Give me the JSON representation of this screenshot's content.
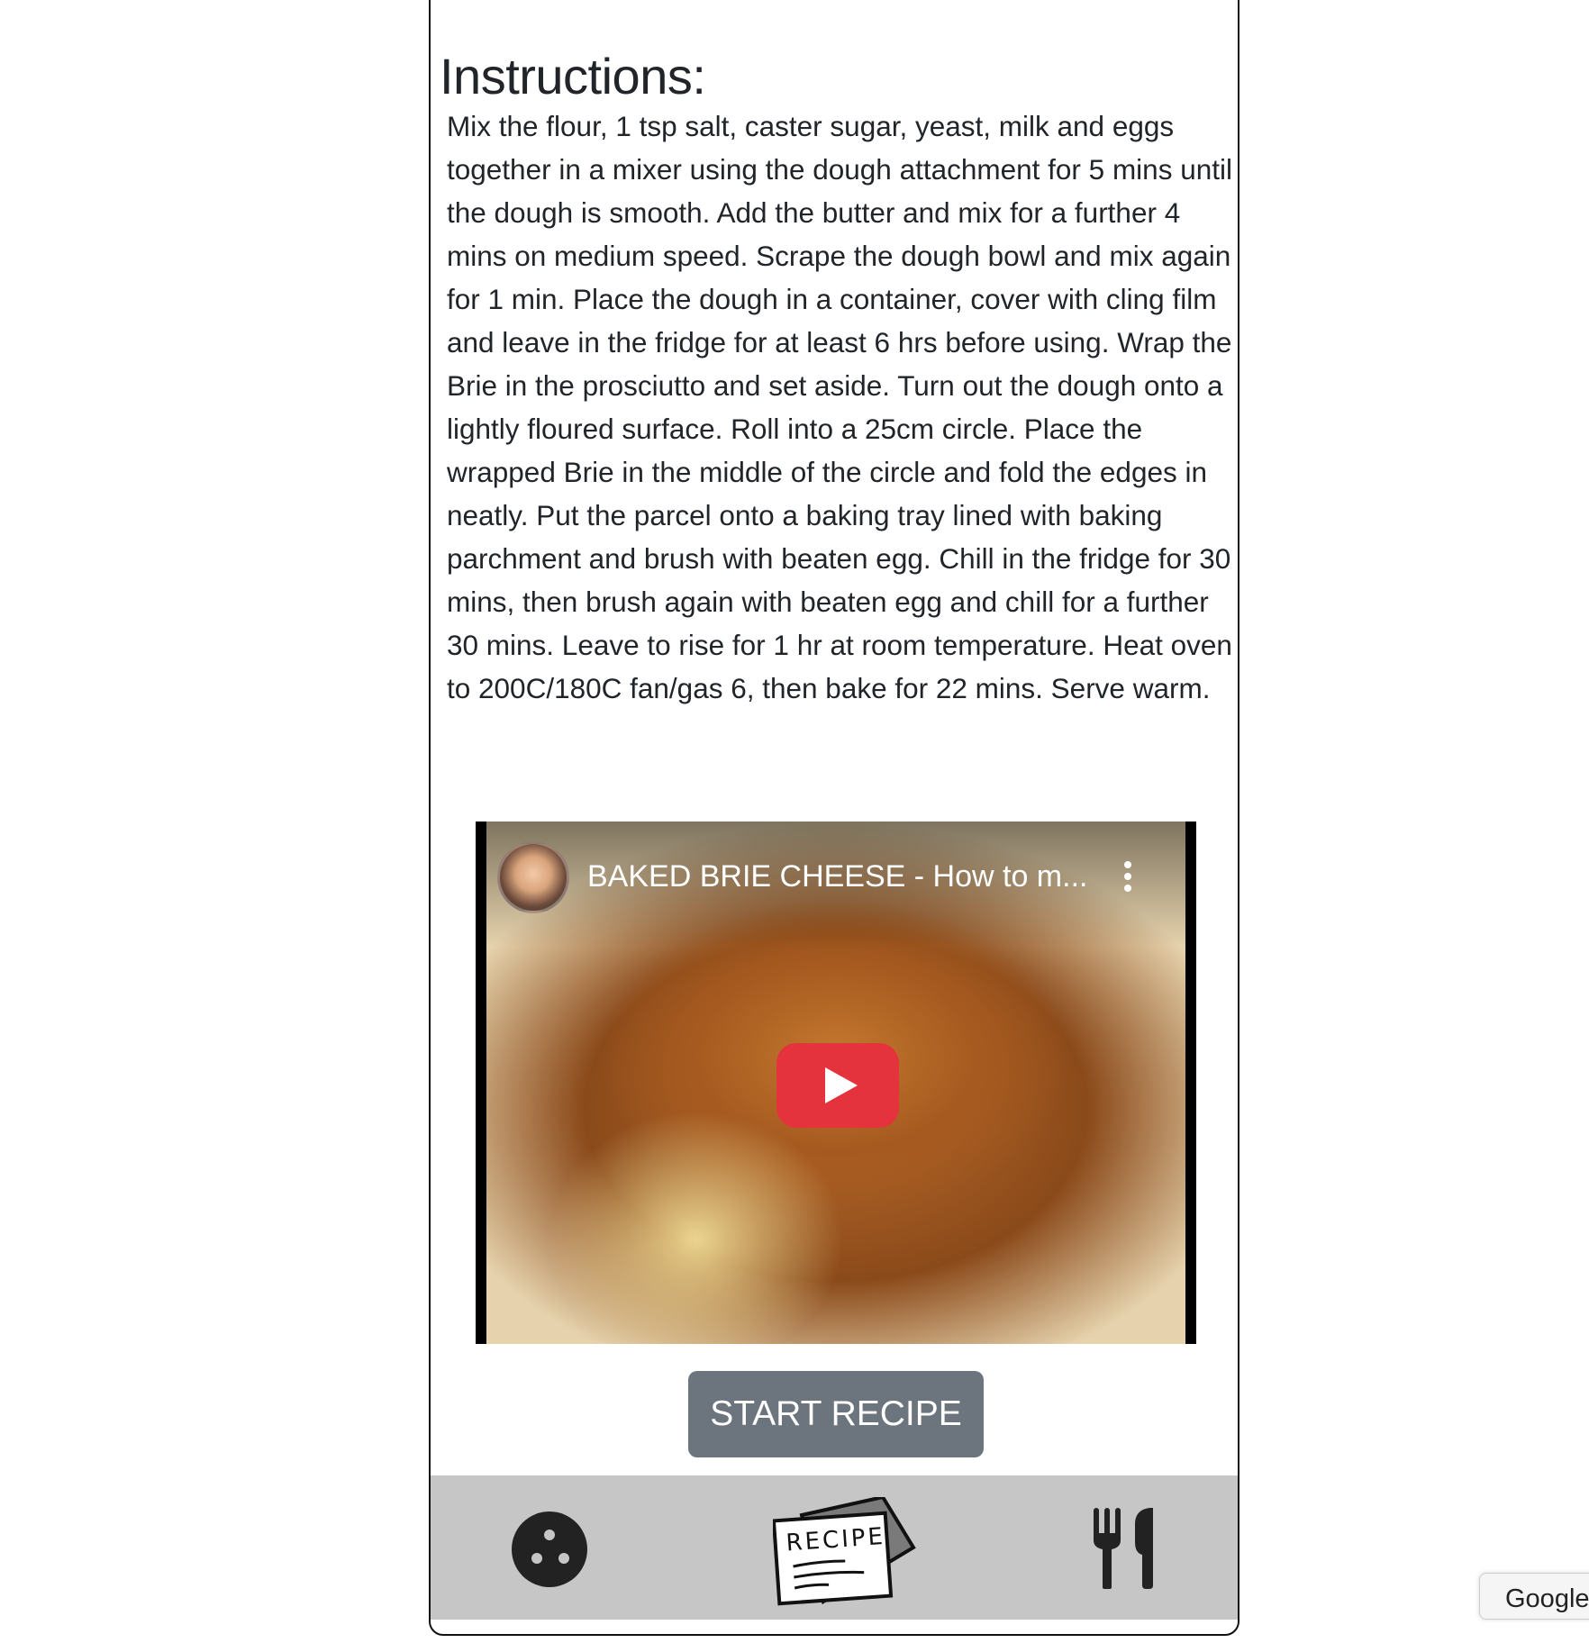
{
  "page": {
    "heading": "Instructions:",
    "instructions": "Mix the flour, 1 tsp salt, caster sugar, yeast, milk and eggs together in a mixer using the dough attachment for 5 mins until the dough is smooth. Add the butter and mix for a further 4 mins on medium speed. Scrape the dough bowl and mix again for 1 min. Place the dough in a container, cover with cling film and leave in the fridge for at least 6 hrs before using. Wrap the Brie in the prosciutto and set aside. Turn out the dough onto a lightly floured surface. Roll into a 25cm circle. Place the wrapped Brie in the middle of the circle and fold the edges in neatly. Put the parcel onto a baking tray lined with baking parchment and brush with beaten egg. Chill in the fridge for 30 mins, then brush again with beaten egg and chill for a further 30 mins. Leave to rise for 1 hr at room temperature. Heat oven to 200C/180C fan/gas 6, then bake for 22 mins. Serve warm."
  },
  "video": {
    "title": "BAKED BRIE CHEESE - How to m...",
    "play_color": "#e5333d"
  },
  "actions": {
    "start_label": "START RECIPE",
    "button_color": "#6c757d"
  },
  "nav": {
    "background": "#c6c6c6",
    "items": [
      {
        "icon": "cookie-icon"
      },
      {
        "icon": "recipe-card-icon",
        "text": "RECIPE"
      },
      {
        "icon": "fork-knife-icon"
      }
    ]
  },
  "browser": {
    "google_tab": "Google"
  }
}
